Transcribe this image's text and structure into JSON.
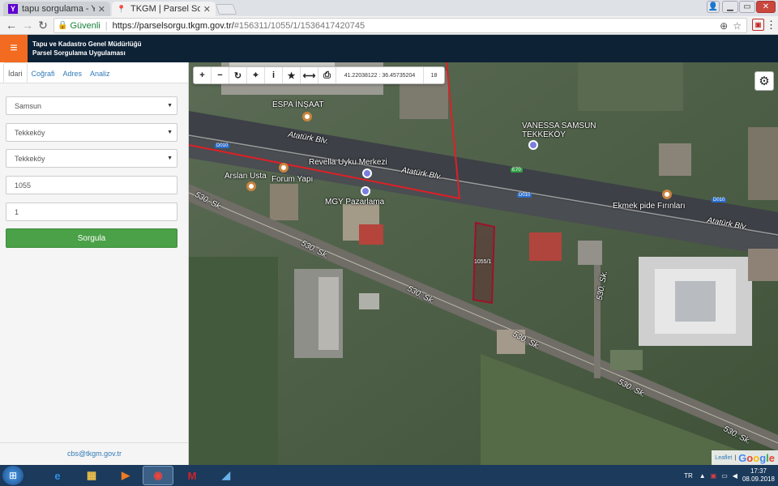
{
  "browser": {
    "tabs": [
      {
        "title": "tapu sorgulama - Yahoo",
        "icon": "yahoo-icon",
        "active": false
      },
      {
        "title": "TKGM | Parsel Sorgulama",
        "icon": "map-pin-icon",
        "active": true
      }
    ],
    "secure_label": "Güvenli",
    "url_host": "https://parselsorgu.tkgm.gov.tr/",
    "url_path": "#156311/1055/1/1536417420745"
  },
  "app": {
    "title_line1": "Tapu ve Kadastro Genel Müdürlüğü",
    "title_line2": "Parsel Sorgulama Uygulaması"
  },
  "sidebar": {
    "tabs": [
      "İdari",
      "Coğrafi",
      "Adres",
      "Analiz"
    ],
    "province": "Samsun",
    "district": "Tekkeköy",
    "neighborhood": "Tekkeköy",
    "block": "1055",
    "parcel": "1",
    "submit_label": "Sorgula",
    "email": "cbs@tkgm.gov.tr"
  },
  "map": {
    "coords": "41.22038122 : 36.45735204",
    "zoom": "18",
    "parcel_label": "1055/1",
    "places": {
      "espa": "ESPA İNŞAAT",
      "vanessa1": "VANESSA SAMSUN",
      "vanessa2": "TEKKEKÖY",
      "revella": "Revella Uyku Merkezi",
      "arslan": "Arslan Usta",
      "forum": "Forum Yapı",
      "mgy": "MGY Pazarlama",
      "ekmek": "Ekmek pide Fırınları"
    },
    "roads": {
      "ataturk": "Atatürk Blv.",
      "sk530": "530. Sk."
    },
    "shields": {
      "d010": "D010",
      "e70": "E70"
    },
    "attribution_leaflet": "Leaflet",
    "attribution_google": "Google"
  },
  "taskbar": {
    "lang": "TR",
    "time": "17:37",
    "date": "08.09.2018"
  }
}
